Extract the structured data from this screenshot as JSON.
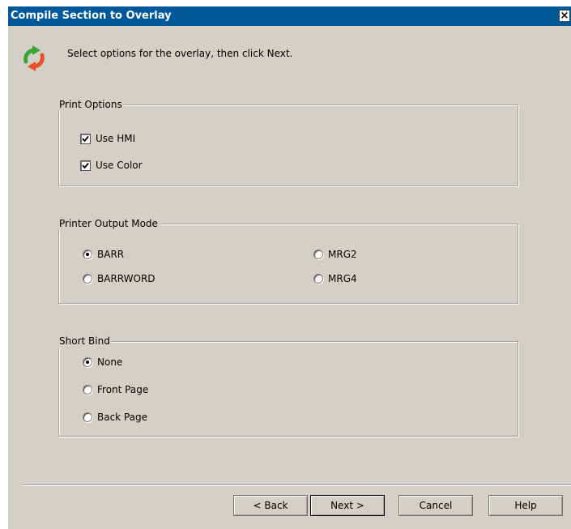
{
  "dialog": {
    "title": "Compile Section to Overlay",
    "close_glyph": "×",
    "header_text": "Select options for the overlay, then click Next.",
    "header_icon": "refresh-arrows-icon"
  },
  "print_options": {
    "legend": "Print Options",
    "use_hmi": {
      "label": "Use HMI",
      "checked": true
    },
    "use_color": {
      "label": "Use Color",
      "checked": true
    }
  },
  "printer_output_mode": {
    "legend": "Printer Output Mode",
    "options": [
      "BARR",
      "BARRWORD",
      "MRG2",
      "MRG4"
    ],
    "selected": "BARR"
  },
  "short_bind": {
    "legend": "Short Bind",
    "options": [
      "None",
      "Front Page",
      "Back Page"
    ],
    "selected": "None"
  },
  "buttons": {
    "back": "< Back",
    "next": "Next >",
    "cancel": "Cancel",
    "help": "Help"
  },
  "colors": {
    "title_bar": "#00579a",
    "dialog_bg": "#d4d0c8"
  }
}
